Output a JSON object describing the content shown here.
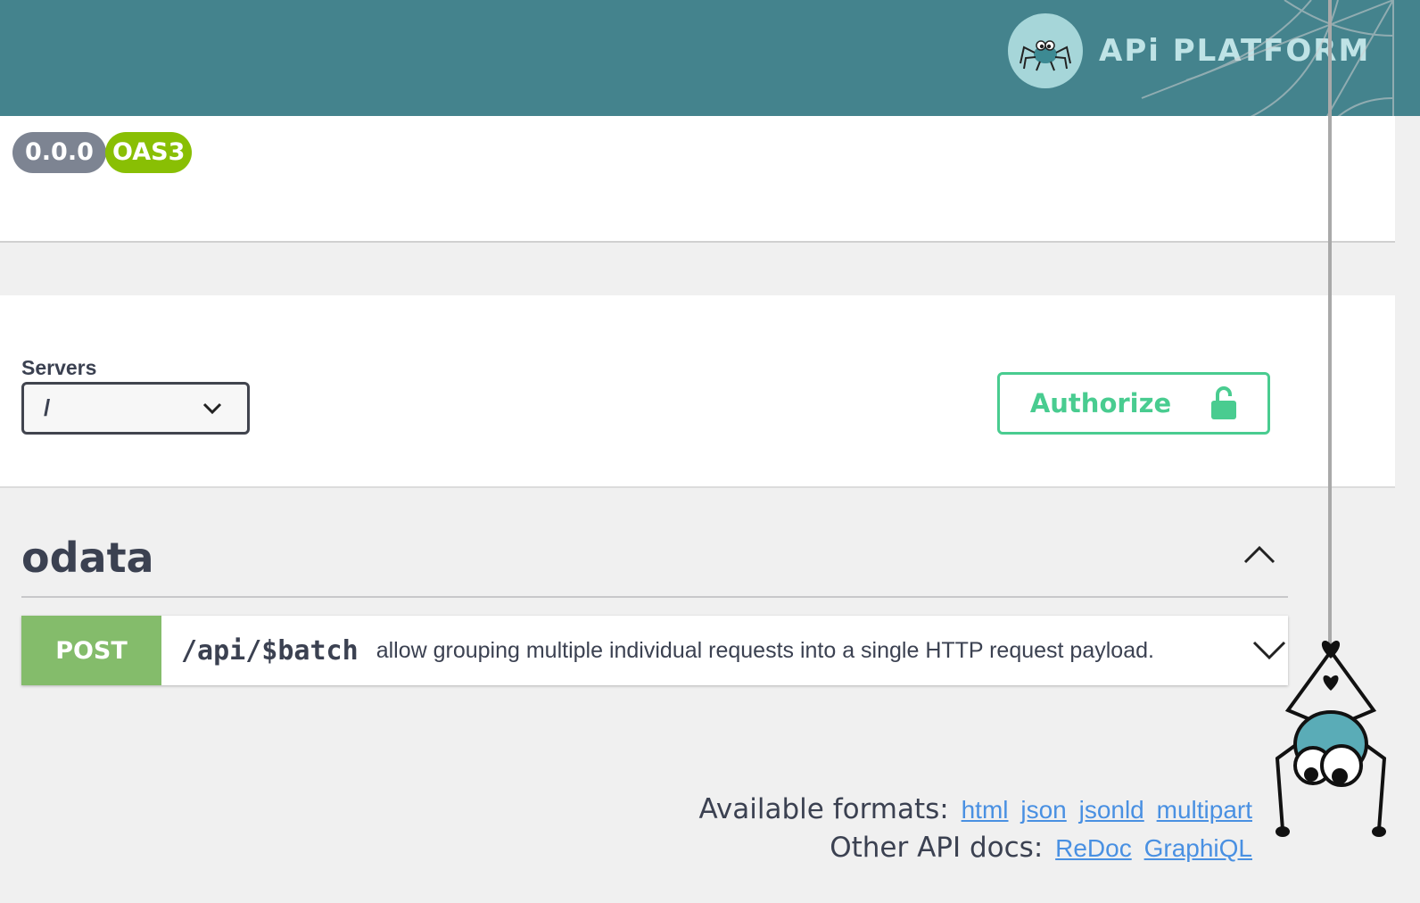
{
  "header": {
    "logo_text": "APi PLATFORM",
    "bg_color": "#44838d"
  },
  "info": {
    "version_badge": "0.0.0",
    "oas_badge": "OAS3"
  },
  "scheme": {
    "servers_label": "Servers",
    "servers_selected": "/",
    "authorize_label": "Authorize"
  },
  "tag": {
    "title": "odata"
  },
  "operation": {
    "method": "POST",
    "path": "/api/$batch",
    "summary": "allow grouping multiple individual requests into a single HTTP request payload."
  },
  "footer": {
    "formats_label": "Available formats:",
    "formats": [
      "html",
      "json",
      "jsonld",
      "multipart"
    ],
    "other_docs_label": "Other API docs:",
    "other_docs": [
      "ReDoc",
      "GraphiQL"
    ]
  },
  "colors": {
    "post": "#84bc6b",
    "authorize": "#49cc90",
    "link": "#4990e2"
  }
}
